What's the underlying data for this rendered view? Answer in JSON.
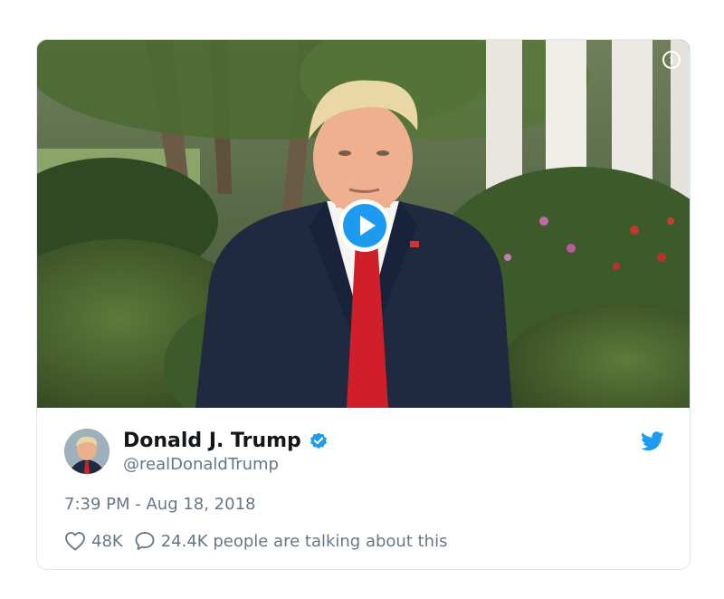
{
  "tweet": {
    "display_name": "Donald J. Trump",
    "handle": "@realDonaldTrump",
    "timestamp": "7:39 PM - Aug 18, 2018",
    "likes": "48K",
    "conversation_text": "24.4K people are talking about this",
    "verified": true
  },
  "media": {
    "type": "video",
    "info_glyph": "i",
    "play_icon": "play-icon"
  },
  "icons": {
    "verified": "verified-badge-icon",
    "brand": "twitter-bird-icon",
    "like": "heart-icon",
    "reply": "speech-bubble-icon"
  },
  "colors": {
    "accent": "#1d9bf0",
    "text_primary": "#14171a",
    "text_secondary": "#657786",
    "border": "#e1e8ed"
  }
}
